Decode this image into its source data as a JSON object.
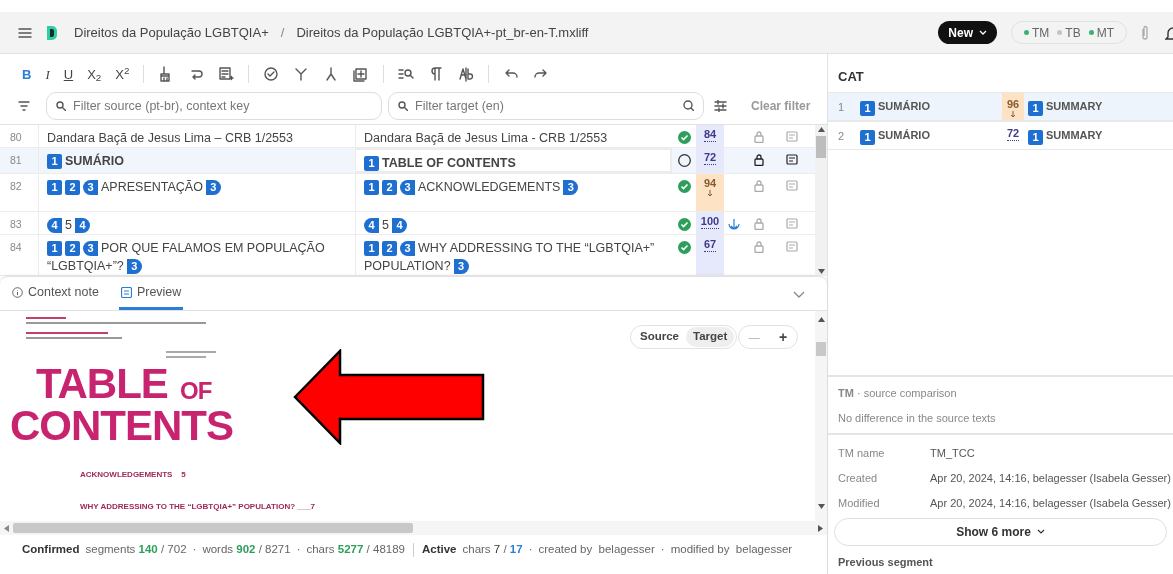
{
  "header": {
    "project": "Direitos da População LGBTQIA+",
    "separator": "/",
    "file": "Direitos da População LGBTQIA+-pt_br-en-T.mxliff",
    "new_button": "New",
    "resources": [
      {
        "label": "TM",
        "color": "#3bb273"
      },
      {
        "label": "TB",
        "color": "#c4c4c4"
      },
      {
        "label": "MT",
        "color": "#3bb273"
      }
    ]
  },
  "toolbar": {
    "format": [
      {
        "label": "B",
        "selected": true
      },
      {
        "label": "I",
        "selected": false
      },
      {
        "label": "U",
        "selected": false
      },
      {
        "label": "X$_{2}$",
        "selected": false
      },
      {
        "label": "X$^{2}$",
        "selected": false
      }
    ]
  },
  "filters": {
    "source_placeholder": "Filter source (pt-br), context key",
    "target_placeholder": "Filter target (en)",
    "clear": "Clear filter"
  },
  "segments": [
    {
      "number": "80",
      "selected": false,
      "source": [
        {
          "text": "Dandara Baçã de Jesus Lima – CRB 1/2553"
        }
      ],
      "target": [
        {
          "text": "Dandara Baçã de Jesus Lima - CRB 1/2553"
        }
      ],
      "confirmed": true,
      "score": "84",
      "fuzzy": false,
      "repeated": false
    },
    {
      "number": "81",
      "selected": true,
      "source": [
        {
          "tag": "1",
          "kind": "box"
        },
        {
          "text": "SUMÁRIO"
        }
      ],
      "target": [
        {
          "tag": "1",
          "kind": "box"
        },
        {
          "text": "TABLE OF CONTENTS"
        }
      ],
      "confirmed": false,
      "score": "72",
      "fuzzy": false,
      "repeated": false
    },
    {
      "number": "82",
      "selected": false,
      "source": [
        {
          "tag": "1",
          "kind": "box"
        },
        {
          "tag": "2",
          "kind": "box"
        },
        {
          "tag": "3",
          "kind": "open"
        },
        {
          "text": "APRESENTAÇÃO"
        },
        {
          "tag": "3",
          "kind": "close"
        }
      ],
      "target": [
        {
          "tag": "1",
          "kind": "box"
        },
        {
          "tag": "2",
          "kind": "box"
        },
        {
          "tag": "3",
          "kind": "open"
        },
        {
          "text": "ACKNOWLEDGEMENTS"
        },
        {
          "tag": "3",
          "kind": "close"
        }
      ],
      "confirmed": true,
      "score": "94",
      "fuzzy": true,
      "repeated": false
    },
    {
      "number": "83",
      "selected": false,
      "source": [
        {
          "tag": "4",
          "kind": "open"
        },
        {
          "text": "5"
        },
        {
          "tag": "4",
          "kind": "close"
        }
      ],
      "target": [
        {
          "tag": "4",
          "kind": "open"
        },
        {
          "text": "5"
        },
        {
          "tag": "4",
          "kind": "close"
        }
      ],
      "confirmed": true,
      "score": "100",
      "fuzzy": false,
      "repeated": true
    },
    {
      "number": "84",
      "selected": false,
      "source": [
        {
          "tag": "1",
          "kind": "box"
        },
        {
          "tag": "2",
          "kind": "box"
        },
        {
          "tag": "3",
          "kind": "open"
        },
        {
          "text": "POR QUE FALAMOS EM POPULAÇÃO"
        },
        {
          "text": "“LGBTQIA+”?"
        },
        {
          "tag": "3",
          "kind": "close"
        }
      ],
      "target": [
        {
          "tag": "1",
          "kind": "box"
        },
        {
          "tag": "2",
          "kind": "box"
        },
        {
          "tag": "3",
          "kind": "open"
        },
        {
          "text": "WHY ADDRESSING TO THE “LGBTQIA+”"
        },
        {
          "text": "POPULATION?"
        },
        {
          "tag": "3",
          "kind": "close"
        }
      ],
      "confirmed": true,
      "score": "67",
      "fuzzy": false,
      "repeated": false
    }
  ],
  "bottom_tabs": [
    {
      "label": "Context note",
      "selected": false
    },
    {
      "label": "Preview",
      "selected": true
    }
  ],
  "preview": {
    "toggle": [
      {
        "label": "Source",
        "selected": false
      },
      {
        "label": "Target",
        "selected": true
      }
    ],
    "zoom_out": "—",
    "zoom_in": "+",
    "title": [
      "TABLE",
      "OF",
      "CONTENTS"
    ],
    "toc": [
      "ACKNOWLEDGEMENTS    5",
      "WHY ADDRESSING TO THE “LGBTQIA+” POPULATION? ___7"
    ]
  },
  "status_bar": {
    "groups": [
      {
        "label": "Confirmed",
        "stats": [
          {
            "name": "segments",
            "value": "140",
            "total": "702",
            "value_highlighted": true,
            "total_highlighted": false
          },
          {
            "name": "words",
            "value": "902",
            "total": "8271",
            "value_highlighted": true,
            "total_highlighted": false
          },
          {
            "name": "chars",
            "value": "5277",
            "total": "48189",
            "value_highlighted": true,
            "total_highlighted": false
          }
        ]
      },
      {
        "label": "Active",
        "stats": [
          {
            "name": "chars",
            "value": "7",
            "total": "17",
            "value_highlighted": false,
            "total_highlighted": true
          }
        ]
      }
    ],
    "slash": "/",
    "dot": "·",
    "created": "created by  belagesser",
    "modified": "modified by  belagesser"
  },
  "cat": {
    "title": "CAT",
    "matches": [
      {
        "index": "1",
        "source_tag": "1",
        "source": "SUMÁRIO",
        "score": "96",
        "fuzzy": true,
        "target_tag": "1",
        "target": "SUMMARY"
      },
      {
        "index": "2",
        "source_tag": "1",
        "source": "SUMÁRIO",
        "score": "72",
        "fuzzy": false,
        "target_tag": "1",
        "target": "SUMMARY"
      }
    ]
  },
  "tm_comparison": {
    "title": "**TM** · source comparison",
    "message": "No difference in the source texts"
  },
  "tm_details": [
    {
      "label": "TM name",
      "value": "TM_TCC"
    },
    {
      "label": "Created",
      "value": "Apr 20, 2024, 14:16, belagesser (Isabela Gesser)"
    },
    {
      "label": "Modified",
      "value": "Apr 20, 2024, 14:16, belagesser (Isabela Gesser)"
    }
  ],
  "show_more": "Show 6 more",
  "previous_segment": "Previous segment"
}
